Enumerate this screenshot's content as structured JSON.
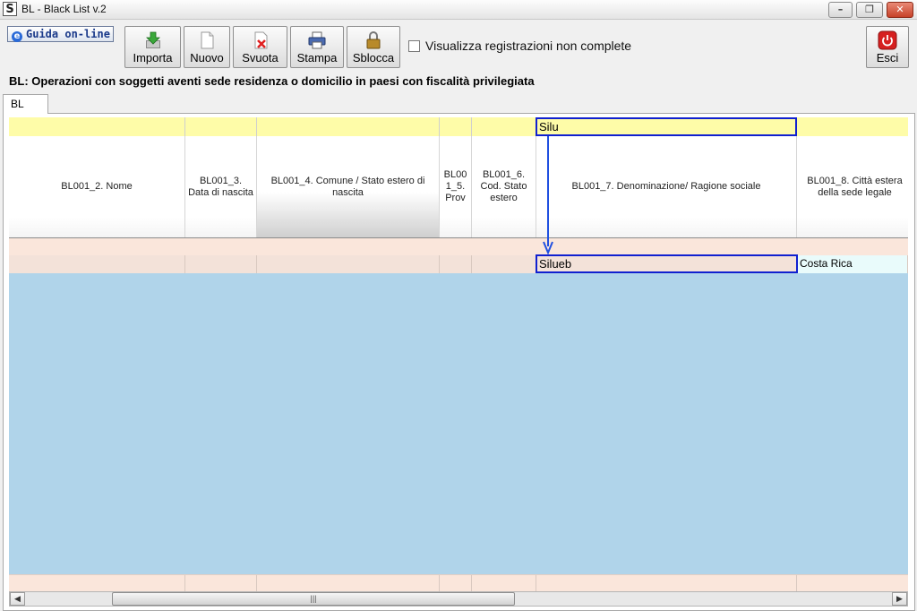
{
  "window": {
    "title": "BL - Black List v.2",
    "app_icon": "S"
  },
  "window_buttons": {
    "minimize": "–",
    "restore": "❐",
    "close": "✕"
  },
  "guida_button": {
    "label": "Guida on-line",
    "icon": "e"
  },
  "toolbar": [
    {
      "id": "importa",
      "label": "Importa",
      "icon": "import-icon"
    },
    {
      "id": "nuovo",
      "label": "Nuovo",
      "icon": "new-document-icon"
    },
    {
      "id": "svuota",
      "label": "Svuota",
      "icon": "delete-document-icon"
    },
    {
      "id": "stampa",
      "label": "Stampa",
      "icon": "printer-icon"
    },
    {
      "id": "sblocca",
      "label": "Sblocca",
      "icon": "padlock-icon"
    }
  ],
  "checkbox": {
    "label": "Visualizza registrazioni non complete",
    "checked": false
  },
  "esci": {
    "label": "Esci",
    "icon": "power-icon"
  },
  "subtitle": "BL: Operazioni con soggetti aventi sede residenza o domicilio in paesi con fiscalità privilegiata",
  "tab": "BL",
  "grid": {
    "columns": [
      "BL001_2. Nome",
      "BL001_3. Data di nascita",
      "BL001_4. Comune / Stato estero di nascita",
      "BL00 1_5. Prov",
      "BL001_6. Cod. Stato estero",
      "BL001_7. Denominazione/ Ragione sociale",
      "BL001_8. Città estera della sede legale"
    ],
    "filter_value": "Silu",
    "row": {
      "denominazione": "Silueb",
      "citta": "Costa Rica"
    }
  },
  "colors": {
    "highlight": "#1020d0",
    "arrow": "#2050e0",
    "grid_bg": "#b0d4ea",
    "band": "#fefca8"
  }
}
